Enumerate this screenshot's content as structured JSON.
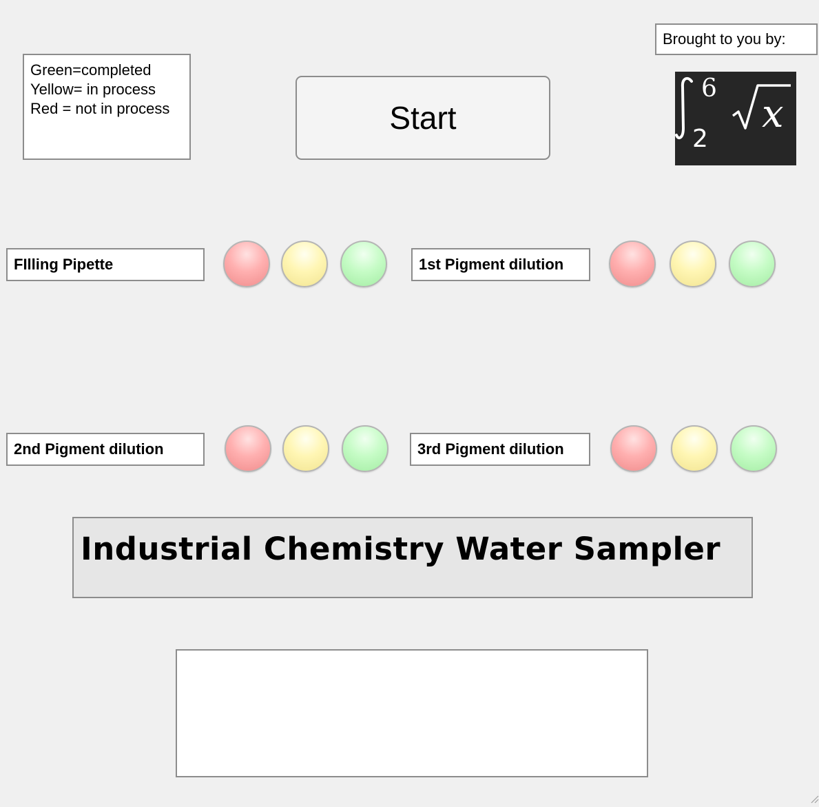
{
  "legend": {
    "lines": [
      "Green=completed",
      "Yellow= in process",
      "Red = not in process"
    ]
  },
  "start_button": {
    "label": "Start"
  },
  "credit": {
    "label": "Brought to you by:"
  },
  "logo": {
    "lower_limit": "2",
    "upper_limit": "6",
    "variable": "x"
  },
  "stages": [
    {
      "label": "FIlling Pipette",
      "lamps": [
        "red",
        "yellow",
        "green"
      ]
    },
    {
      "label": "1st Pigment dilution",
      "lamps": [
        "red",
        "yellow",
        "green"
      ]
    },
    {
      "label": "2nd Pigment dilution",
      "lamps": [
        "red",
        "yellow",
        "green"
      ]
    },
    {
      "label": "3rd Pigment dilution",
      "lamps": [
        "red",
        "yellow",
        "green"
      ]
    }
  ],
  "title": {
    "text": "Industrial Chemistry Water Sampler"
  },
  "output": {
    "text": ""
  },
  "colors": {
    "background": "#f0f0f0",
    "lamp_red": "#ffb0b0",
    "lamp_yellow": "#fff6b4",
    "lamp_green": "#c6fcc6",
    "logo_background": "#262626"
  }
}
